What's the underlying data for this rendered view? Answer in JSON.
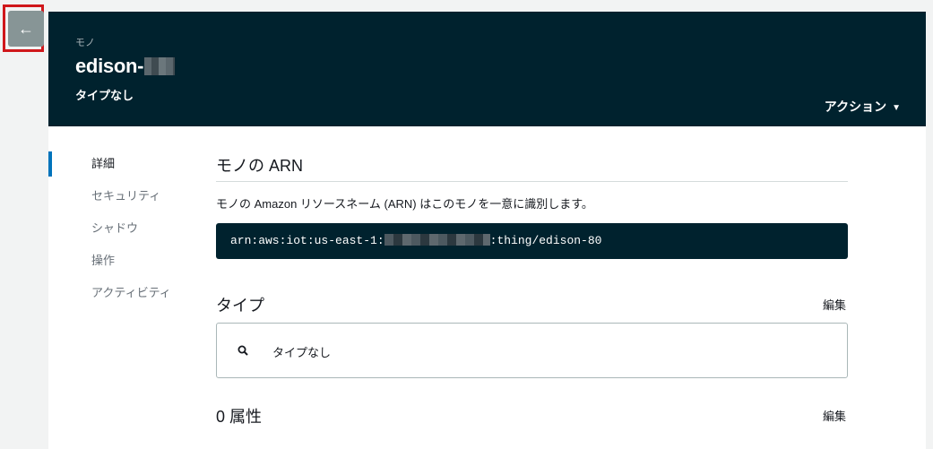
{
  "header": {
    "breadcrumb": "モノ",
    "title": "edison-",
    "subtitle": "タイプなし",
    "actions_label": "アクション"
  },
  "nav": {
    "items": [
      {
        "label": "詳細",
        "active": true
      },
      {
        "label": "セキュリティ",
        "active": false
      },
      {
        "label": "シャドウ",
        "active": false
      },
      {
        "label": "操作",
        "active": false
      },
      {
        "label": "アクティビティ",
        "active": false
      }
    ]
  },
  "arn": {
    "heading": "モノの ARN",
    "description": "モノの Amazon リソースネーム (ARN) はこのモノを一意に識別します。",
    "value_prefix": "arn:aws:iot:us-east-1:",
    "value_suffix": ":thing/edison-80"
  },
  "type_section": {
    "heading": "タイプ",
    "edit_label": "編集",
    "value": "タイプなし"
  },
  "attributes": {
    "heading": "0 属性",
    "edit_label": "編集"
  },
  "colors": {
    "header_bg": "#00222e",
    "active_indicator": "#0073bb",
    "highlight_border": "#d0171b"
  }
}
